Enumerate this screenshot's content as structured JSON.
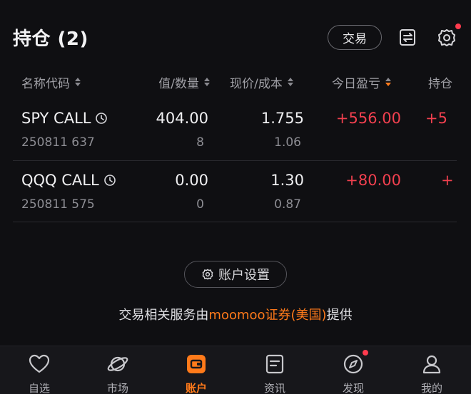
{
  "header": {
    "title": "持仓 (2)",
    "trade_label": "交易",
    "icons": [
      "transfer-icon",
      "settings-gear-icon"
    ],
    "notification_color": "#ff3b4e"
  },
  "columns": [
    {
      "label": "名称代码"
    },
    {
      "label": "值/数量"
    },
    {
      "label": "现价/成本"
    },
    {
      "label": "今日盈亏",
      "sorted": "desc"
    },
    {
      "label": "持仓"
    }
  ],
  "positions": [
    {
      "name": "SPY CALL",
      "code": "250811 637",
      "market_value": "404.00",
      "quantity": "8",
      "price": "1.755",
      "cost": "1.06",
      "today_pl": "+556.00",
      "position_pl": "+5"
    },
    {
      "name": "QQQ CALL",
      "code": "250811 575",
      "market_value": "0.00",
      "quantity": "0",
      "price": "1.30",
      "cost": "0.87",
      "today_pl": "+80.00",
      "position_pl": "+"
    }
  ],
  "account_settings_label": "账户设置",
  "service_text": {
    "prefix": "交易相关服务由",
    "broker": "moomoo证券(美国)",
    "suffix": "提供"
  },
  "tabs": [
    {
      "label": "自选",
      "icon": "heart-icon"
    },
    {
      "label": "市场",
      "icon": "planet-icon"
    },
    {
      "label": "账户",
      "icon": "wallet-icon",
      "active": true
    },
    {
      "label": "资讯",
      "icon": "news-icon"
    },
    {
      "label": "发现",
      "icon": "compass-icon",
      "badge": true
    },
    {
      "label": "我的",
      "icon": "profile-icon"
    }
  ],
  "colors": {
    "accent": "#ff7a1a",
    "profit": "#f2404f",
    "background": "#0f0f12"
  }
}
